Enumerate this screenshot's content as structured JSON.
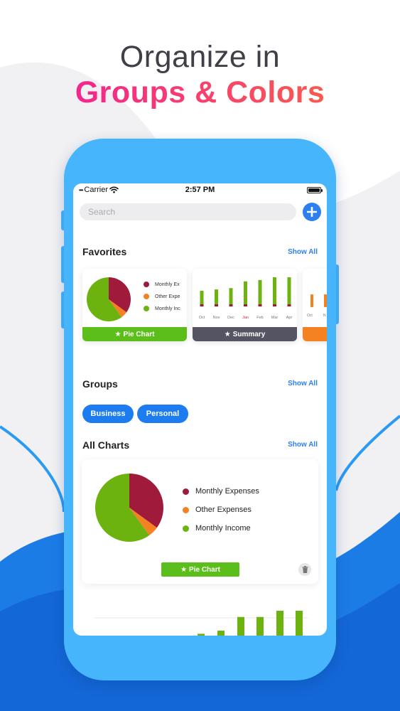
{
  "headline": {
    "line1": "Organize in",
    "line2": "Groups & Colors"
  },
  "status_bar": {
    "carrier": "Carrier",
    "time": "2:57 PM"
  },
  "search": {
    "placeholder": "Search"
  },
  "favorites": {
    "title": "Favorites",
    "show_all": "Show All",
    "cards": [
      {
        "type_label": "Pie Chart",
        "legend": [
          "Monthly Ex",
          "Other Expe",
          "Monthly Inc"
        ]
      },
      {
        "type_label": "Summary",
        "months": [
          "Oct",
          "Nov",
          "Dec",
          "Jan",
          "Feb",
          "Mar",
          "Apr"
        ]
      },
      {
        "months": [
          "Oct",
          "N"
        ]
      }
    ]
  },
  "groups": {
    "title": "Groups",
    "show_all": "Show All",
    "items": [
      "Business",
      "Personal"
    ]
  },
  "all_charts": {
    "title": "All Charts",
    "show_all": "Show All",
    "card": {
      "type_label": "Pie Chart",
      "legend": [
        "Monthly Expenses",
        "Other Expenses",
        "Monthly Income"
      ]
    }
  },
  "chart_data": [
    {
      "type": "pie",
      "labels": [
        "Monthly Expenses",
        "Other Expenses",
        "Monthly Income"
      ],
      "values": [
        35,
        5,
        60
      ],
      "colors": [
        "#a01a3c",
        "#f58220",
        "#6cb30f"
      ]
    },
    {
      "type": "bar",
      "categories": [
        "Oct",
        "Nov",
        "Dec",
        "Jan",
        "Feb",
        "Mar",
        "Apr"
      ],
      "series": [
        {
          "values": [
            20,
            22,
            24,
            34,
            36,
            40,
            40
          ],
          "color": "#6cb30f"
        },
        {
          "values": [
            3,
            3,
            3,
            3,
            3,
            3,
            3
          ],
          "color": "#a01a3c"
        }
      ]
    }
  ],
  "colors": {
    "accent_blue": "#2d7ff0",
    "pill_blue": "#1c7cf0",
    "phone_frame": "#46b5fb",
    "pie_green": "#5cbe1a",
    "summary_gray": "#545463",
    "orange": "#f58220",
    "maroon": "#a01a3c"
  }
}
